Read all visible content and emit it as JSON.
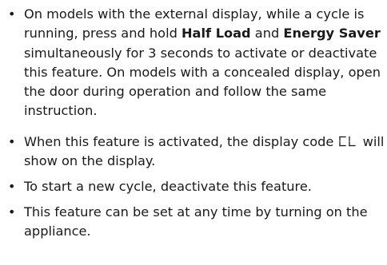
{
  "items": [
    {
      "t1": "On models with the external display, while a cycle is running, press and hold ",
      "b1": "Half Load",
      "t2": " and ",
      "b2": "Energy Saver",
      "t3": " simultaneously for 3 seconds to activate or deactivate this feature. On models with a concealed display, open the door during operation and follow the same instruction."
    },
    {
      "t1": "When this feature is activated, the display code ",
      "code": "CL",
      "t2": " will show on the display."
    },
    {
      "t1": "To start a new cycle, deactivate this feature."
    },
    {
      "t1": "This feature can be set at any time by turning on the appliance."
    }
  ],
  "colors": {
    "text": "#1a1a1a"
  },
  "icons": {
    "bullet": "bullet-dot",
    "code_display": "segment-display-CL"
  }
}
